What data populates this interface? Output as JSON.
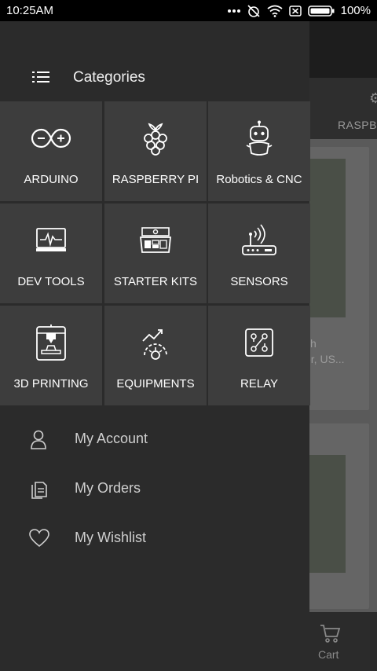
{
  "status_bar": {
    "time": "10:25AM",
    "battery_percent": "100%",
    "icons": [
      "more-dots-icon",
      "alarm-off-icon",
      "wifi-icon",
      "sim-off-icon",
      "battery-icon"
    ]
  },
  "background_app": {
    "tab_label": "RASPB",
    "card_text_line1": "ith",
    "card_text_line2": "er, US...",
    "cart_label": "Cart"
  },
  "drawer": {
    "title": "Categories",
    "categories": [
      {
        "label": "ARDUINO",
        "icon": "arduino-infinity-icon"
      },
      {
        "label": "RASPBERRY PI",
        "icon": "raspberry-icon"
      },
      {
        "label": "Robotics & CNC",
        "icon": "robot-icon"
      },
      {
        "label": "DEV TOOLS",
        "icon": "monitor-waveform-icon"
      },
      {
        "label": "STARTER KITS",
        "icon": "kit-box-icon"
      },
      {
        "label": "SENSORS",
        "icon": "router-signal-icon"
      },
      {
        "label": "3D PRINTING",
        "icon": "3d-printer-icon"
      },
      {
        "label": "EQUIPMENTS",
        "icon": "gear-chart-icon"
      },
      {
        "label": "RELAY",
        "icon": "circuit-board-icon"
      }
    ],
    "menu": [
      {
        "label": "My Account",
        "icon": "person-icon"
      },
      {
        "label": "My Orders",
        "icon": "orders-icon"
      },
      {
        "label": "My Wishlist",
        "icon": "heart-icon"
      }
    ]
  },
  "colors": {
    "drawer_bg": "#2b2b2b",
    "tile_bg": "#3d3d3d",
    "status_bar_bg": "#000000",
    "text_primary": "#ffffff",
    "text_secondary": "#cfcfcf"
  }
}
